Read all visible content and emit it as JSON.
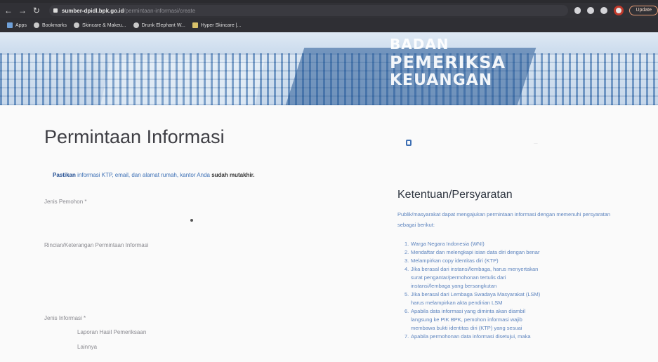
{
  "browser": {
    "url_host": "sumber-dpidl.bpk.go.id",
    "url_path": "/permintaan-informasi/create",
    "update_label": "Update"
  },
  "bookmarks": [
    {
      "label": "Apps",
      "icon": "apps-grid-icon"
    },
    {
      "label": "Bookmarks",
      "icon": "star-icon"
    },
    {
      "label": "Skincare & Makeu...",
      "icon": "globe-icon"
    },
    {
      "label": "Drunk Elephant W...",
      "icon": "globe-icon"
    },
    {
      "label": "Hyper Skincare |...",
      "icon": "grid-icon"
    }
  ],
  "banner": {
    "line1": "BADAN",
    "line2": "PEMERIKSA",
    "line3": "KEUANGAN"
  },
  "main": {
    "title": "Permintaan Informasi",
    "notice_lead": "Pastikan",
    "notice_body": " informasi KTP, email, dan alamat rumah, kantor Anda ",
    "notice_tail": "sudah mutakhir.",
    "jenis_pemohon_label": "Jenis Pemohon *",
    "rincian_label": "Rincian/Keterangan Permintaan Informasi",
    "jenis_informasi_label": "Jenis Informasi *",
    "jenis_informasi_options": [
      "Laporan Hasil Pemeriksaan",
      "Lainnya"
    ]
  },
  "sidebar": {
    "faint_text": "...",
    "requirements_title": "Ketentuan/Persyaratan",
    "requirements_intro": "Publik/masyarakat dapat mengajukan permintaan informasi dengan memenuhi persyaratan sebagai berikut:",
    "requirements": [
      "Warga Negara Indonesia (WNI)",
      "Mendaftar dan melengkapi isian data diri dengan benar",
      "Melampirkan copy identitas diri (KTP)",
      "Jika berasal dari instansi/lembaga, harus menyertakan",
      "surat pengantar/permohonan tertulis dari",
      "instansi/lembaga yang bersangkutan",
      "Jika berasal dari Lembaga Swadaya Masyarakat (LSM)",
      "harus melampirkan akta pendirian LSM",
      "Apabila data informasi yang diminta akan diambil",
      "langsung ke PIK BPK, pemohon informasi wajib",
      "membawa bukti identitas diri (KTP) yang sesuai",
      "Apabila permohonan data informasi disetujui, maka"
    ],
    "requirements_numbers": [
      "1.",
      "2.",
      "3.",
      "4.",
      "",
      "",
      "5.",
      "",
      "6.",
      "",
      "",
      "7."
    ]
  }
}
